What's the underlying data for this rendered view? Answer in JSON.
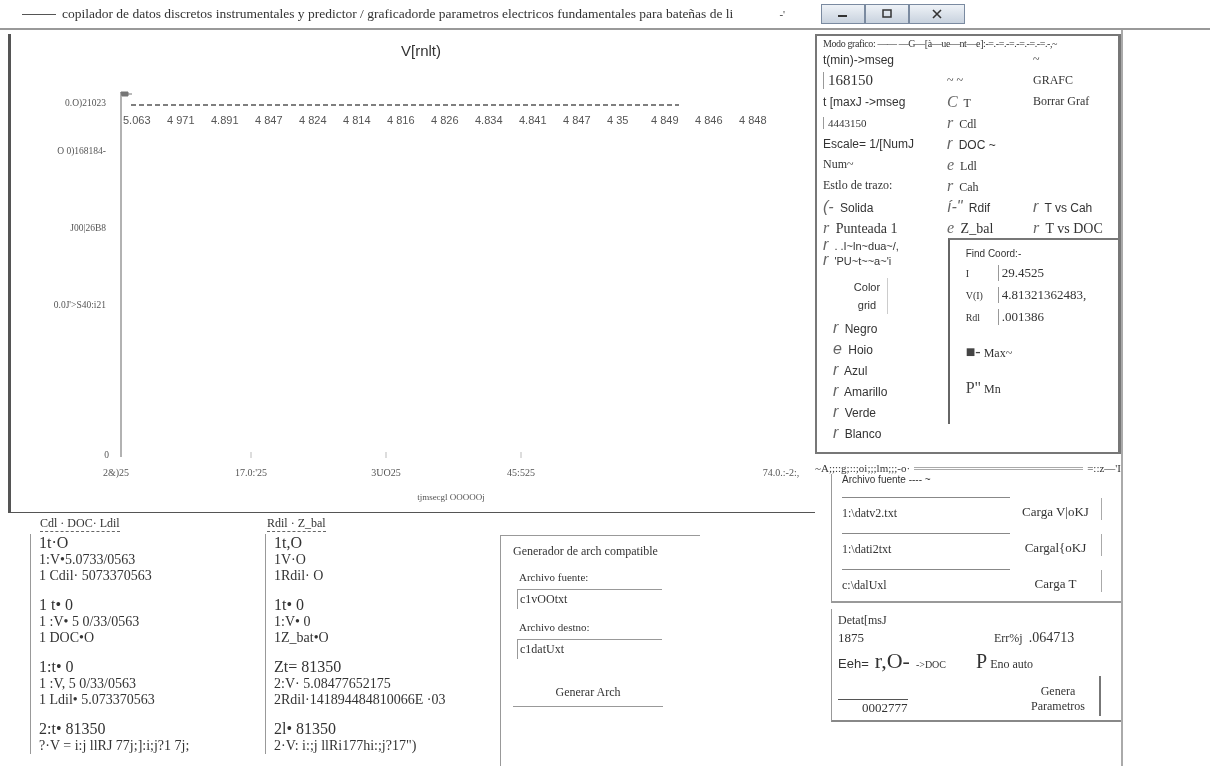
{
  "window": {
    "title": "copilador de datos discretos instrumentales y predictor / graficadorde parametros electricos fundamentales para bateñas de li",
    "title_tail": "-'"
  },
  "chart": {
    "title": "V[rnlt)",
    "y_labels": [
      "0.O)21023",
      "O 0)168184-",
      "J00|26B8",
      "0.0J'>S40:i21",
      "0"
    ],
    "point_labels": [
      "5.063",
      "4 971",
      "4.891",
      "4 847",
      "4  824",
      "4 814",
      "4  816",
      "4  826",
      "4.834",
      "4.841",
      "4  847",
      "4  35",
      "4  849",
      "4  846",
      "4  848"
    ],
    "x_labels": [
      "2&)25",
      "17.0:'25",
      "3UO25",
      "45:525",
      "74.0.:-2:,"
    ],
    "x_axis_label": "tjmsecgl OOOOOj"
  },
  "controls": {
    "mode_label": "Modo grafico: —— —G—[à—ue—nt—e]:-=.-=.-=.-=.-=.-=.-,~",
    "tmin_label": "t(min)->mseg",
    "tmin_value": "168150",
    "tilde": "~",
    "tilde_pair": "~ ~",
    "graph_button": "GRAFC",
    "tmax_label": "t [maxJ ->mseg",
    "clear_button": "Borrar Graf",
    "tmax_value": "4443150",
    "scale_label": "Escale= 1/[NumJ",
    "num_label": "Num~",
    "style_label": "Estlo de trazo:",
    "styles": [
      {
        "mark": "(-",
        "label": "Solida"
      },
      {
        "mark": "r",
        "label": "Punteada 1"
      },
      {
        "mark": "r",
        "label": ". .I~ln~dua~/,"
      },
      {
        "mark": "r",
        "label": "'PU~t~~a~'i"
      }
    ],
    "variables": [
      {
        "mark": "C",
        "label": "T"
      },
      {
        "mark": "r",
        "label": "Cdl"
      },
      {
        "mark": "r",
        "label": "DOC ~"
      },
      {
        "mark": "e",
        "label": "Ldl"
      },
      {
        "mark": "r",
        "label": "Cah"
      },
      {
        "mark": "í-\"",
        "label": "Rdif"
      },
      {
        "mark": "e",
        "label": "Z_bal"
      }
    ],
    "plots": [
      {
        "mark": "r",
        "label": "T vs Cah"
      },
      {
        "mark": "r",
        "label": "T vs DOC"
      }
    ],
    "color_label": "Color grid",
    "colors": [
      {
        "mark": "r",
        "label": "Negro"
      },
      {
        "mark": "e",
        "label": "Hoio"
      },
      {
        "mark": "r",
        "label": "Azul"
      },
      {
        "mark": "r",
        "label": "Amarillo"
      },
      {
        "mark": "r",
        "label": "Verde"
      },
      {
        "mark": "r",
        "label": "Blanco"
      }
    ]
  },
  "coords": {
    "title": "Find  Coord:-",
    "rows": [
      {
        "label": "I",
        "value": "29.4525"
      },
      {
        "label": "V(I)",
        "value": "4.81321362483,"
      },
      {
        "label": "Rdl",
        "value": ".001386"
      }
    ],
    "options": [
      {
        "mark": "■-",
        "label": "Max~"
      },
      {
        "mark": "P\"",
        "label": "Mn"
      }
    ]
  },
  "separator": {
    "text": "~A;;::g;::;oi;;;lm;;;-o·",
    "tail": "=::z—'I"
  },
  "files": {
    "title": "Archivo  fuente ---- ~",
    "rows": [
      {
        "path": "1:\\datv2.txt",
        "button": "Carga V|oKJ"
      },
      {
        "path": "1:\\dati2txt",
        "button": "Cargal{oKJ"
      },
      {
        "path": "c:\\dalUxl",
        "button": "Carga  T"
      }
    ]
  },
  "delta": {
    "label": "Detat[msJ",
    "value": "1875",
    "err_label": "Err%j",
    "err_value": ".064713",
    "auto_mark": "P",
    "auto_label": "Eno auto",
    "eeh_label": "Eeh=",
    "eeh_value": "r,O-",
    "eeh_unit": "->DOC",
    "button": "Genera Parametros",
    "result": "0002777"
  },
  "readouts": {
    "headers": [
      "Cdl · DOC· Ldil",
      "Rdil · Z_bal"
    ],
    "columns": [
      [
        [
          "1t·O",
          "1:V•5.0733/0563",
          "1 Cdil·  5073370563"
        ],
        [
          "1 t• 0",
          "1 :V• 5 0/33/0563",
          "1 DOC•O"
        ],
        [
          "1:t•  0",
          "1 :V, 5 0/33/0563",
          " 1 Ldil•  5.073370563"
        ],
        [
          "2:t• 81350",
          "?·V = i:j llRJ  77j;]:i;j?1  7j;"
        ]
      ],
      [
        [
          "1t,O",
          "1V·O",
          "1Rdil· O"
        ],
        [
          "1t•  0",
          "1:V• 0",
          "1Z_bat•O"
        ],
        [
          "Zt= 81350",
          "2:V· 5.08477652175",
          "2Rdil·141894484810066E  ·03"
        ],
        [
          "2l•  81350",
          "2·V: i:;j llRi177hi:;j?17\")"
        ]
      ]
    ]
  },
  "generator": {
    "title": "Generador de arch compatible",
    "source_label": "Archivo fuente:",
    "source_value": "c1vOOtxt",
    "dest_label": "Archivo destno:",
    "dest_value": "c1datUxt",
    "button": "Generar  Arch"
  }
}
